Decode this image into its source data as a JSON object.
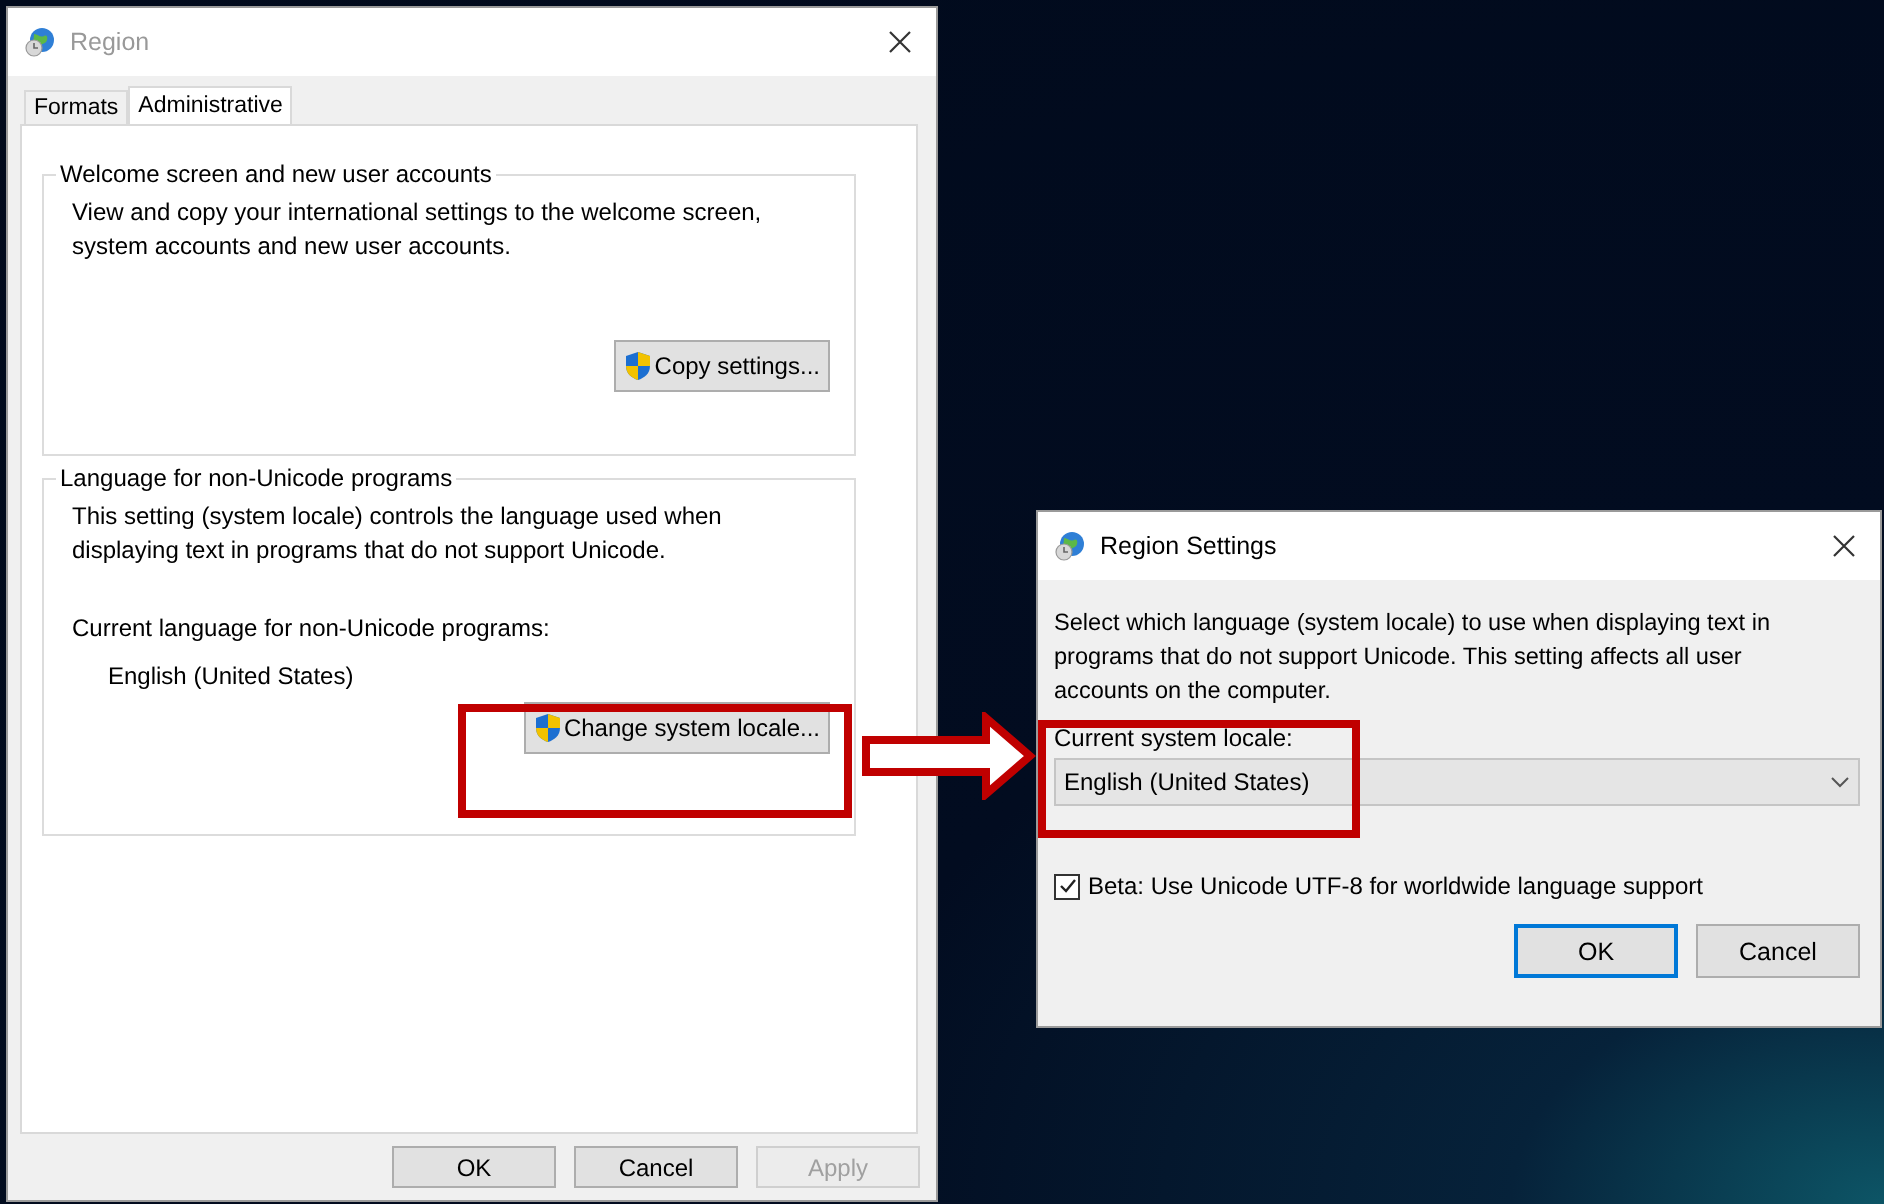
{
  "region_window": {
    "title": "Region",
    "tabs": [
      {
        "label": "Formats",
        "selected": false
      },
      {
        "label": "Administrative",
        "selected": true
      }
    ],
    "groups": [
      {
        "title": "Welcome screen and new user accounts",
        "description": "View and copy your international settings to the welcome screen, system accounts and new user accounts.",
        "button": "Copy settings..."
      },
      {
        "title": "Language for non-Unicode programs",
        "description": "This setting (system locale) controls the language used when displaying text in programs that do not support Unicode.",
        "current_label": "Current language for non-Unicode programs:",
        "current_value": "English (United States)",
        "button": "Change system locale..."
      }
    ],
    "buttons": [
      {
        "label": "OK",
        "disabled": false
      },
      {
        "label": "Cancel",
        "disabled": false
      },
      {
        "label": "Apply",
        "disabled": true
      }
    ]
  },
  "region_settings_dialog": {
    "title": "Region Settings",
    "description": "Select which language (system locale) to use when displaying text in programs that do not support Unicode. This setting affects all user accounts on the computer.",
    "locale_label": "Current system locale:",
    "locale_value": "English (United States)",
    "beta_checkbox": {
      "label": "Beta: Use Unicode UTF-8 for worldwide language support",
      "checked": true
    },
    "buttons": [
      {
        "label": "OK",
        "default": true
      },
      {
        "label": "Cancel",
        "default": false
      }
    ]
  }
}
